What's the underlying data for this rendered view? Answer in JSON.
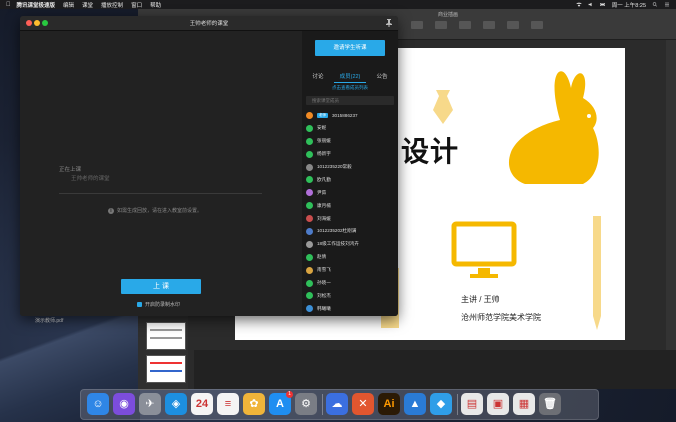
{
  "menubar": {
    "app_name": "腾讯课堂极速版",
    "items": [
      "编辑",
      "课堂",
      "播放控制",
      "窗口",
      "帮助"
    ],
    "clock": "周一 上午8:25"
  },
  "keynote": {
    "window_title": "商业插画",
    "slide": {
      "title": "画设计",
      "lecturer": "主讲 / 王帅",
      "college": "沧州师范学院美术学院"
    }
  },
  "desktop": {
    "file_label": "演示教师.pdf"
  },
  "classroom": {
    "window_title": "王帅老师的课堂",
    "status_label": "正在上课",
    "status_sub": "王帅老师的课堂",
    "hint": "如需生成回放，请在进入教室前设置。",
    "start_button": "上 课",
    "watermark_label": "开启防录制水印",
    "panel": {
      "invite_button": "邀请学生听课",
      "tabs": [
        "讨论",
        "成员(22)",
        "公告"
      ],
      "active_tab": 1,
      "view_list": "点击查看成员列表",
      "search_placeholder": "搜索课堂成员",
      "members": [
        {
          "name": "3015886237",
          "badge": "老师",
          "color": "#f08a24"
        },
        {
          "name": "安妮",
          "color": "#2fbf5a"
        },
        {
          "name": "张丽媛",
          "color": "#2fbf5a"
        },
        {
          "name": "杨新宇",
          "color": "#2fbf5a"
        },
        {
          "name": "1012235220常毅",
          "color": "#888888"
        },
        {
          "name": "欧凡勤",
          "color": "#2fbf5a"
        },
        {
          "name": "尹茹",
          "color": "#b06fd8"
        },
        {
          "name": "康月楠",
          "color": "#2fbf5a"
        },
        {
          "name": "刘海媛",
          "color": "#c94d4d"
        },
        {
          "name": "1012235202杜刚满",
          "color": "#4d7bc9"
        },
        {
          "name": "18级工作运技刘鸿卉",
          "color": "#9a9a9a"
        },
        {
          "name": "赵倩",
          "color": "#2fbf5a"
        },
        {
          "name": "南雪飞",
          "color": "#d9a441"
        },
        {
          "name": "孙晓一",
          "color": "#2fbf5a"
        },
        {
          "name": "刘松杰",
          "color": "#2fbf5a"
        },
        {
          "name": "韩曦曦",
          "color": "#3c8fd6"
        }
      ]
    }
  },
  "dock": {
    "items": [
      {
        "name": "finder-icon",
        "glyph": "☺",
        "color": "#2f86e6"
      },
      {
        "name": "siri-icon",
        "glyph": "◉",
        "color": "#7c4ddc"
      },
      {
        "name": "launchpad-icon",
        "glyph": "✈",
        "color": "#8a8f99"
      },
      {
        "name": "safari-icon",
        "glyph": "◈",
        "color": "#1d8fe0"
      },
      {
        "name": "calendar-icon",
        "glyph": "24",
        "color": "#f4f4f4"
      },
      {
        "name": "reminders-icon",
        "glyph": "≡",
        "color": "#f4f4f4"
      },
      {
        "name": "photos-icon",
        "glyph": "✿",
        "color": "#f0b43a"
      },
      {
        "name": "app-store-icon",
        "glyph": "A",
        "color": "#1f8ef1",
        "badge": "1"
      },
      {
        "name": "system-preferences-icon",
        "glyph": "⚙",
        "color": "#7a7d85"
      },
      {
        "name": "baidu-netdisk-icon",
        "glyph": "☁",
        "color": "#3b6fe0"
      },
      {
        "name": "xmind-icon",
        "glyph": "✕",
        "color": "#e2562f"
      },
      {
        "name": "illustrator-icon",
        "glyph": "Ai",
        "color": "#2b1a05"
      },
      {
        "name": "keynote-icon",
        "glyph": "▲",
        "color": "#2a7bd6"
      },
      {
        "name": "tencent-classroom-icon",
        "glyph": "◆",
        "color": "#2f9ee8"
      },
      {
        "name": "document-icon",
        "glyph": "▤",
        "color": "#e8e8e8"
      },
      {
        "name": "preview-icon",
        "glyph": "▣",
        "color": "#e8e8e8"
      },
      {
        "name": "screenshot-icon",
        "glyph": "▦",
        "color": "#e8e8e8"
      },
      {
        "name": "trash-icon",
        "glyph": "🗑",
        "color": "#6d6f75"
      }
    ]
  }
}
